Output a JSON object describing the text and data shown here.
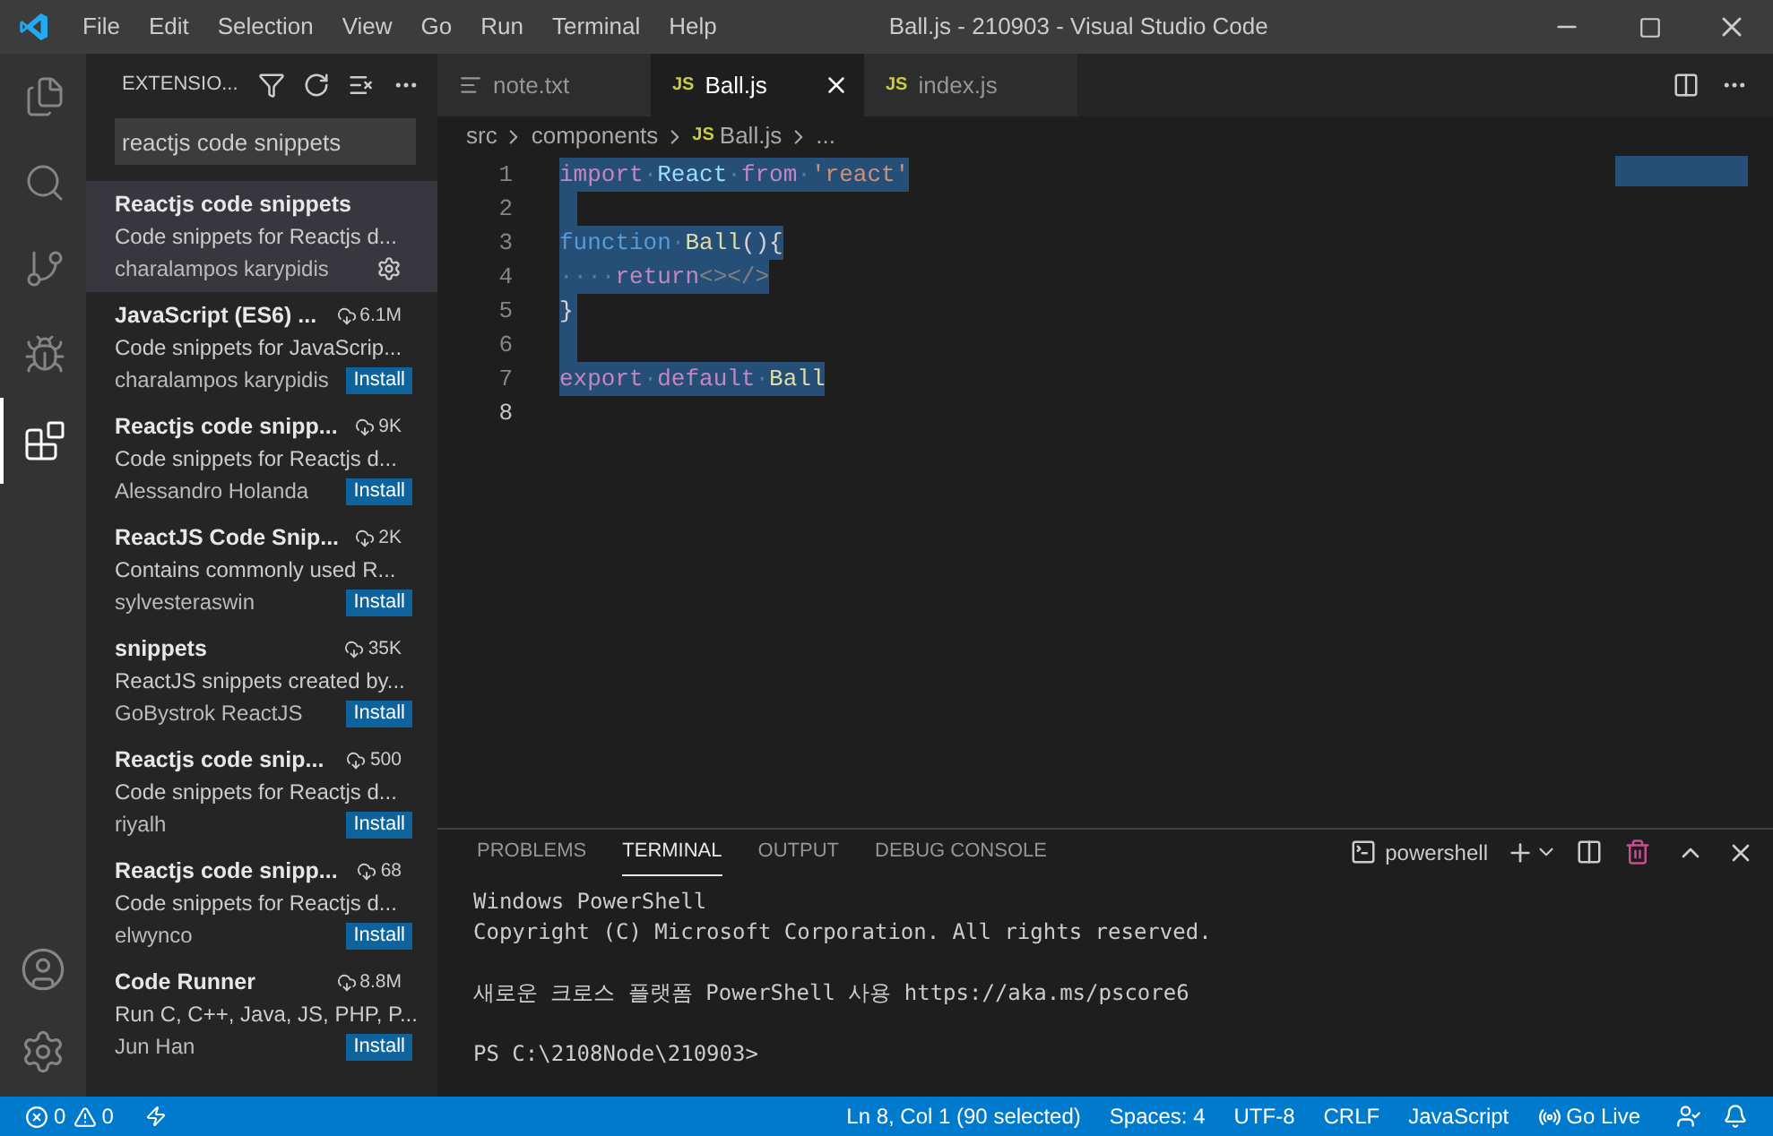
{
  "title_bar": {
    "menu": [
      "File",
      "Edit",
      "Selection",
      "View",
      "Go",
      "Run",
      "Terminal",
      "Help"
    ],
    "title": "Ball.js - 210903 - Visual Studio Code"
  },
  "activity_bar": [
    {
      "kind": "explorer",
      "selected": false
    },
    {
      "kind": "search",
      "selected": false
    },
    {
      "kind": "source-control",
      "selected": false
    },
    {
      "kind": "run",
      "selected": false
    },
    {
      "kind": "extensions",
      "selected": true
    }
  ],
  "sidebar": {
    "title": "EXTENSIO...",
    "search": {
      "value": "reactjs code snippets"
    },
    "extensions": [
      {
        "name": "Reactjs code snippets",
        "description": "Code snippets for Reactjs d...",
        "publisher": "charalampos karypidis",
        "installed": true,
        "selected": true
      },
      {
        "name": "JavaScript (ES6) ...",
        "downloads": "6.1M",
        "description": "Code snippets for JavaScrip...",
        "publisher": "charalampos karypidis",
        "action": "Install",
        "installed": false,
        "selected": false
      },
      {
        "name": "Reactjs code snipp...",
        "downloads": "9K",
        "description": "Code snippets for Reactjs d...",
        "publisher": "Alessandro Holanda",
        "action": "Install",
        "installed": false,
        "selected": false
      },
      {
        "name": "ReactJS Code Snip...",
        "downloads": "2K",
        "description": "Contains commonly used R...",
        "publisher": "sylvesteraswin",
        "action": "Install",
        "installed": false,
        "selected": false
      },
      {
        "name": "snippets",
        "downloads": "35K",
        "description": "ReactJS snippets created by...",
        "publisher": "GoBystrok ReactJS",
        "action": "Install",
        "installed": false,
        "selected": false
      },
      {
        "name": "Reactjs code snip...",
        "downloads": "500",
        "description": "Code snippets for Reactjs d...",
        "publisher": "riyalh",
        "action": "Install",
        "installed": false,
        "selected": false
      },
      {
        "name": "Reactjs code snipp...",
        "downloads": "68",
        "description": "Code snippets for Reactjs d...",
        "publisher": "elwynco",
        "action": "Install",
        "installed": false,
        "selected": false
      },
      {
        "name": "Code Runner",
        "downloads": "8.8M",
        "description": "Run C, C++, Java, JS, PHP, P...",
        "publisher": "Jun Han",
        "action": "Install",
        "installed": false,
        "selected": false
      }
    ]
  },
  "editor": {
    "tabs": [
      {
        "label": "note.txt",
        "kind": "text",
        "selected": false
      },
      {
        "label": "Ball.js",
        "kind": "js",
        "icon": "JS",
        "selected": true
      },
      {
        "label": "index.js",
        "kind": "js",
        "icon": "JS",
        "selected": false
      }
    ],
    "breadcrumb": [
      {
        "text": "src"
      },
      {
        "text": "components"
      },
      {
        "text": "Ball.js",
        "icon": "JS"
      },
      {
        "text": "..."
      }
    ],
    "lines": [
      {
        "number": "1",
        "selected": true,
        "tokens": [
          {
            "text": "import",
            "kind": "keyword"
          },
          {
            "text": "·",
            "kind": "ws"
          },
          {
            "text": "React",
            "kind": "variable"
          },
          {
            "text": "·",
            "kind": "ws"
          },
          {
            "text": "from",
            "kind": "keyword"
          },
          {
            "text": "·",
            "kind": "ws"
          },
          {
            "text": "'react'",
            "kind": "string"
          }
        ]
      },
      {
        "number": "2",
        "selected": true
      },
      {
        "number": "3",
        "selected": true,
        "tokens": [
          {
            "text": "function",
            "kind": "storage"
          },
          {
            "text": "·",
            "kind": "ws"
          },
          {
            "text": "Ball",
            "kind": "function"
          },
          {
            "text": "(){",
            "kind": "punct"
          }
        ]
      },
      {
        "number": "4",
        "selected": true,
        "tokens": [
          {
            "text": "····",
            "kind": "ws"
          },
          {
            "text": "return",
            "kind": "keyword"
          },
          {
            "text": "<></>",
            "kind": "tag"
          }
        ]
      },
      {
        "number": "5",
        "selected": true,
        "tokens": [
          {
            "text": "}",
            "kind": "punct"
          }
        ]
      },
      {
        "number": "6",
        "selected": true
      },
      {
        "number": "7",
        "selected": true,
        "tokens": [
          {
            "text": "export",
            "kind": "keyword"
          },
          {
            "text": "·",
            "kind": "ws"
          },
          {
            "text": "default",
            "kind": "keyword"
          },
          {
            "text": "·",
            "kind": "ws"
          },
          {
            "text": "Ball",
            "kind": "function"
          }
        ]
      },
      {
        "number": "8",
        "selected": false
      }
    ]
  },
  "panel": {
    "tabs": [
      {
        "label": "PROBLEMS",
        "selected": false
      },
      {
        "label": "TERMINAL",
        "selected": true
      },
      {
        "label": "OUTPUT",
        "selected": false
      },
      {
        "label": "DEBUG CONSOLE",
        "selected": false
      }
    ],
    "shell": "powershell",
    "terminal_blocks": [
      [
        "Windows PowerShell",
        "Copyright (C) Microsoft Corporation. All rights reserved."
      ],
      [
        "새로운 크로스 플랫폼 PowerShell 사용 https://aka.ms/pscore6"
      ],
      [
        "PS C:\\2108Node\\210903>"
      ]
    ]
  },
  "status_bar": {
    "errors": "0",
    "warnings": "0",
    "right": [
      {
        "text": "Ln 8, Col 1 (90 selected)",
        "kind": "text"
      },
      {
        "text": "Spaces: 4",
        "kind": "text"
      },
      {
        "text": "UTF-8",
        "kind": "text"
      },
      {
        "text": "CRLF",
        "kind": "text"
      },
      {
        "text": "JavaScript",
        "kind": "text"
      },
      {
        "text": "Go Live",
        "kind": "live"
      }
    ]
  }
}
